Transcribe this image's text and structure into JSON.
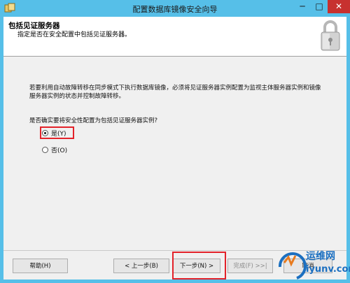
{
  "window": {
    "title": "配置数据库镜像安全向导",
    "minimize_glyph": "─",
    "maximize_glyph": "□",
    "close_glyph": "✕"
  },
  "header": {
    "title": "包括见证服务器",
    "subtitle": "指定是否在安全配置中包括见证服务器。",
    "icon": "lock-icon"
  },
  "body": {
    "description": "若要利用自动故障转移在同步模式下执行数据库镜像，必须将见证服务器实例配置为监视主体服务器实例和镜像服务器实例的状态并控制故障转移。",
    "question": "是否确实要将安全性配置为包括见证服务器实例?",
    "options": [
      {
        "label": "是(Y)",
        "selected": true
      },
      {
        "label": "否(O)",
        "selected": false
      }
    ]
  },
  "buttons": {
    "help": "帮助(H)",
    "back": "< 上一步(B)",
    "next": "下一步(N) >",
    "finish": "完成(F) >>|",
    "cancel": "取消"
  },
  "watermark": {
    "name": "运维网",
    "url": "iyunv.com"
  },
  "colors": {
    "titlebar": "#56bfe8",
    "close": "#c7312f",
    "highlight": "#e3222a"
  }
}
